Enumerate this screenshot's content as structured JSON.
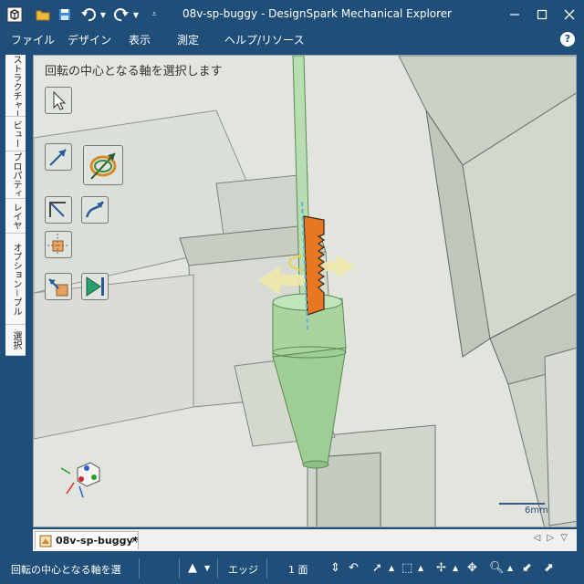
{
  "window": {
    "title": "08v-sp-buggy - DesignSpark Mechanical Explorer",
    "controls": [
      "minimize",
      "maximize",
      "close"
    ]
  },
  "quick_access": {
    "icons": [
      "app-logo-icon",
      "open-folder-icon",
      "save-icon",
      "undo-icon",
      "redo-icon",
      "customize-icon"
    ]
  },
  "menu": {
    "items": [
      "ファイル",
      "デザイン",
      "表示",
      "測定",
      "ヘルプ/リソース"
    ],
    "help": "?"
  },
  "side_tabs": [
    "ストラクチャー",
    "ビュー",
    "プロパティ",
    "レイヤ",
    "オプション－プル",
    "選択"
  ],
  "viewport": {
    "prompt": "回転の中心となる軸を選択します",
    "scale_label": "6mm",
    "colors": {
      "cone": "#a9d4a0",
      "handle": "#e87722",
      "axis": "#5fb4d6",
      "ring": "#e8d44a"
    }
  },
  "tools": [
    "select-icon",
    "direction-icon",
    "revolve-axis-icon",
    "pull-full-icon",
    "pull-up-to-icon",
    "pivot-icon",
    "pull-both-icon",
    "complete-icon"
  ],
  "doc_tab": {
    "label": "08v-sp-buggy*",
    "close": "×"
  },
  "doc_nav": "◁ ▷ ▽",
  "status": {
    "message": "回転の中心となる軸を選",
    "filter": "エッジ",
    "count": "1 面"
  }
}
